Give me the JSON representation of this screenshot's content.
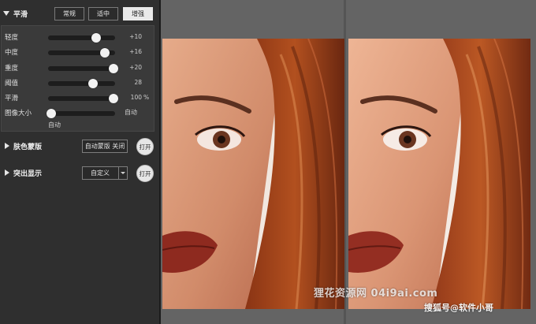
{
  "smoothing": {
    "title": "平滑",
    "modes": [
      "常规",
      "适中",
      "增强"
    ],
    "active_mode": "增强",
    "sliders": [
      {
        "label": "轻度",
        "value_text": "+10",
        "level": 0.72
      },
      {
        "label": "中度",
        "value_text": "+16",
        "level": 0.85
      },
      {
        "label": "重度",
        "value_text": "+20",
        "level": 0.98
      },
      {
        "label": "阈值",
        "value_text": "28",
        "level": 0.67
      },
      {
        "label": "平滑",
        "value_text": "100",
        "unit": "%",
        "level": 0.98
      }
    ],
    "grain": {
      "label": "图像大小",
      "right_text": "自动",
      "under_text": "自动",
      "level": 0.05
    }
  },
  "skin_mask": {
    "title": "肤色蒙版",
    "field_text": "自动蒙版 关闭",
    "button": "打开"
  },
  "highlight": {
    "title": "突出显示",
    "select_value": "自定义",
    "button": "打开"
  },
  "watermarks": {
    "site": "狸花资源网 04i9ai.com",
    "credit": "搜狐号@软件小哥"
  },
  "colors": {
    "panel_bg": "#2f2f2f",
    "preview_bg": "#646464",
    "active_button": "#e9e9e9"
  }
}
